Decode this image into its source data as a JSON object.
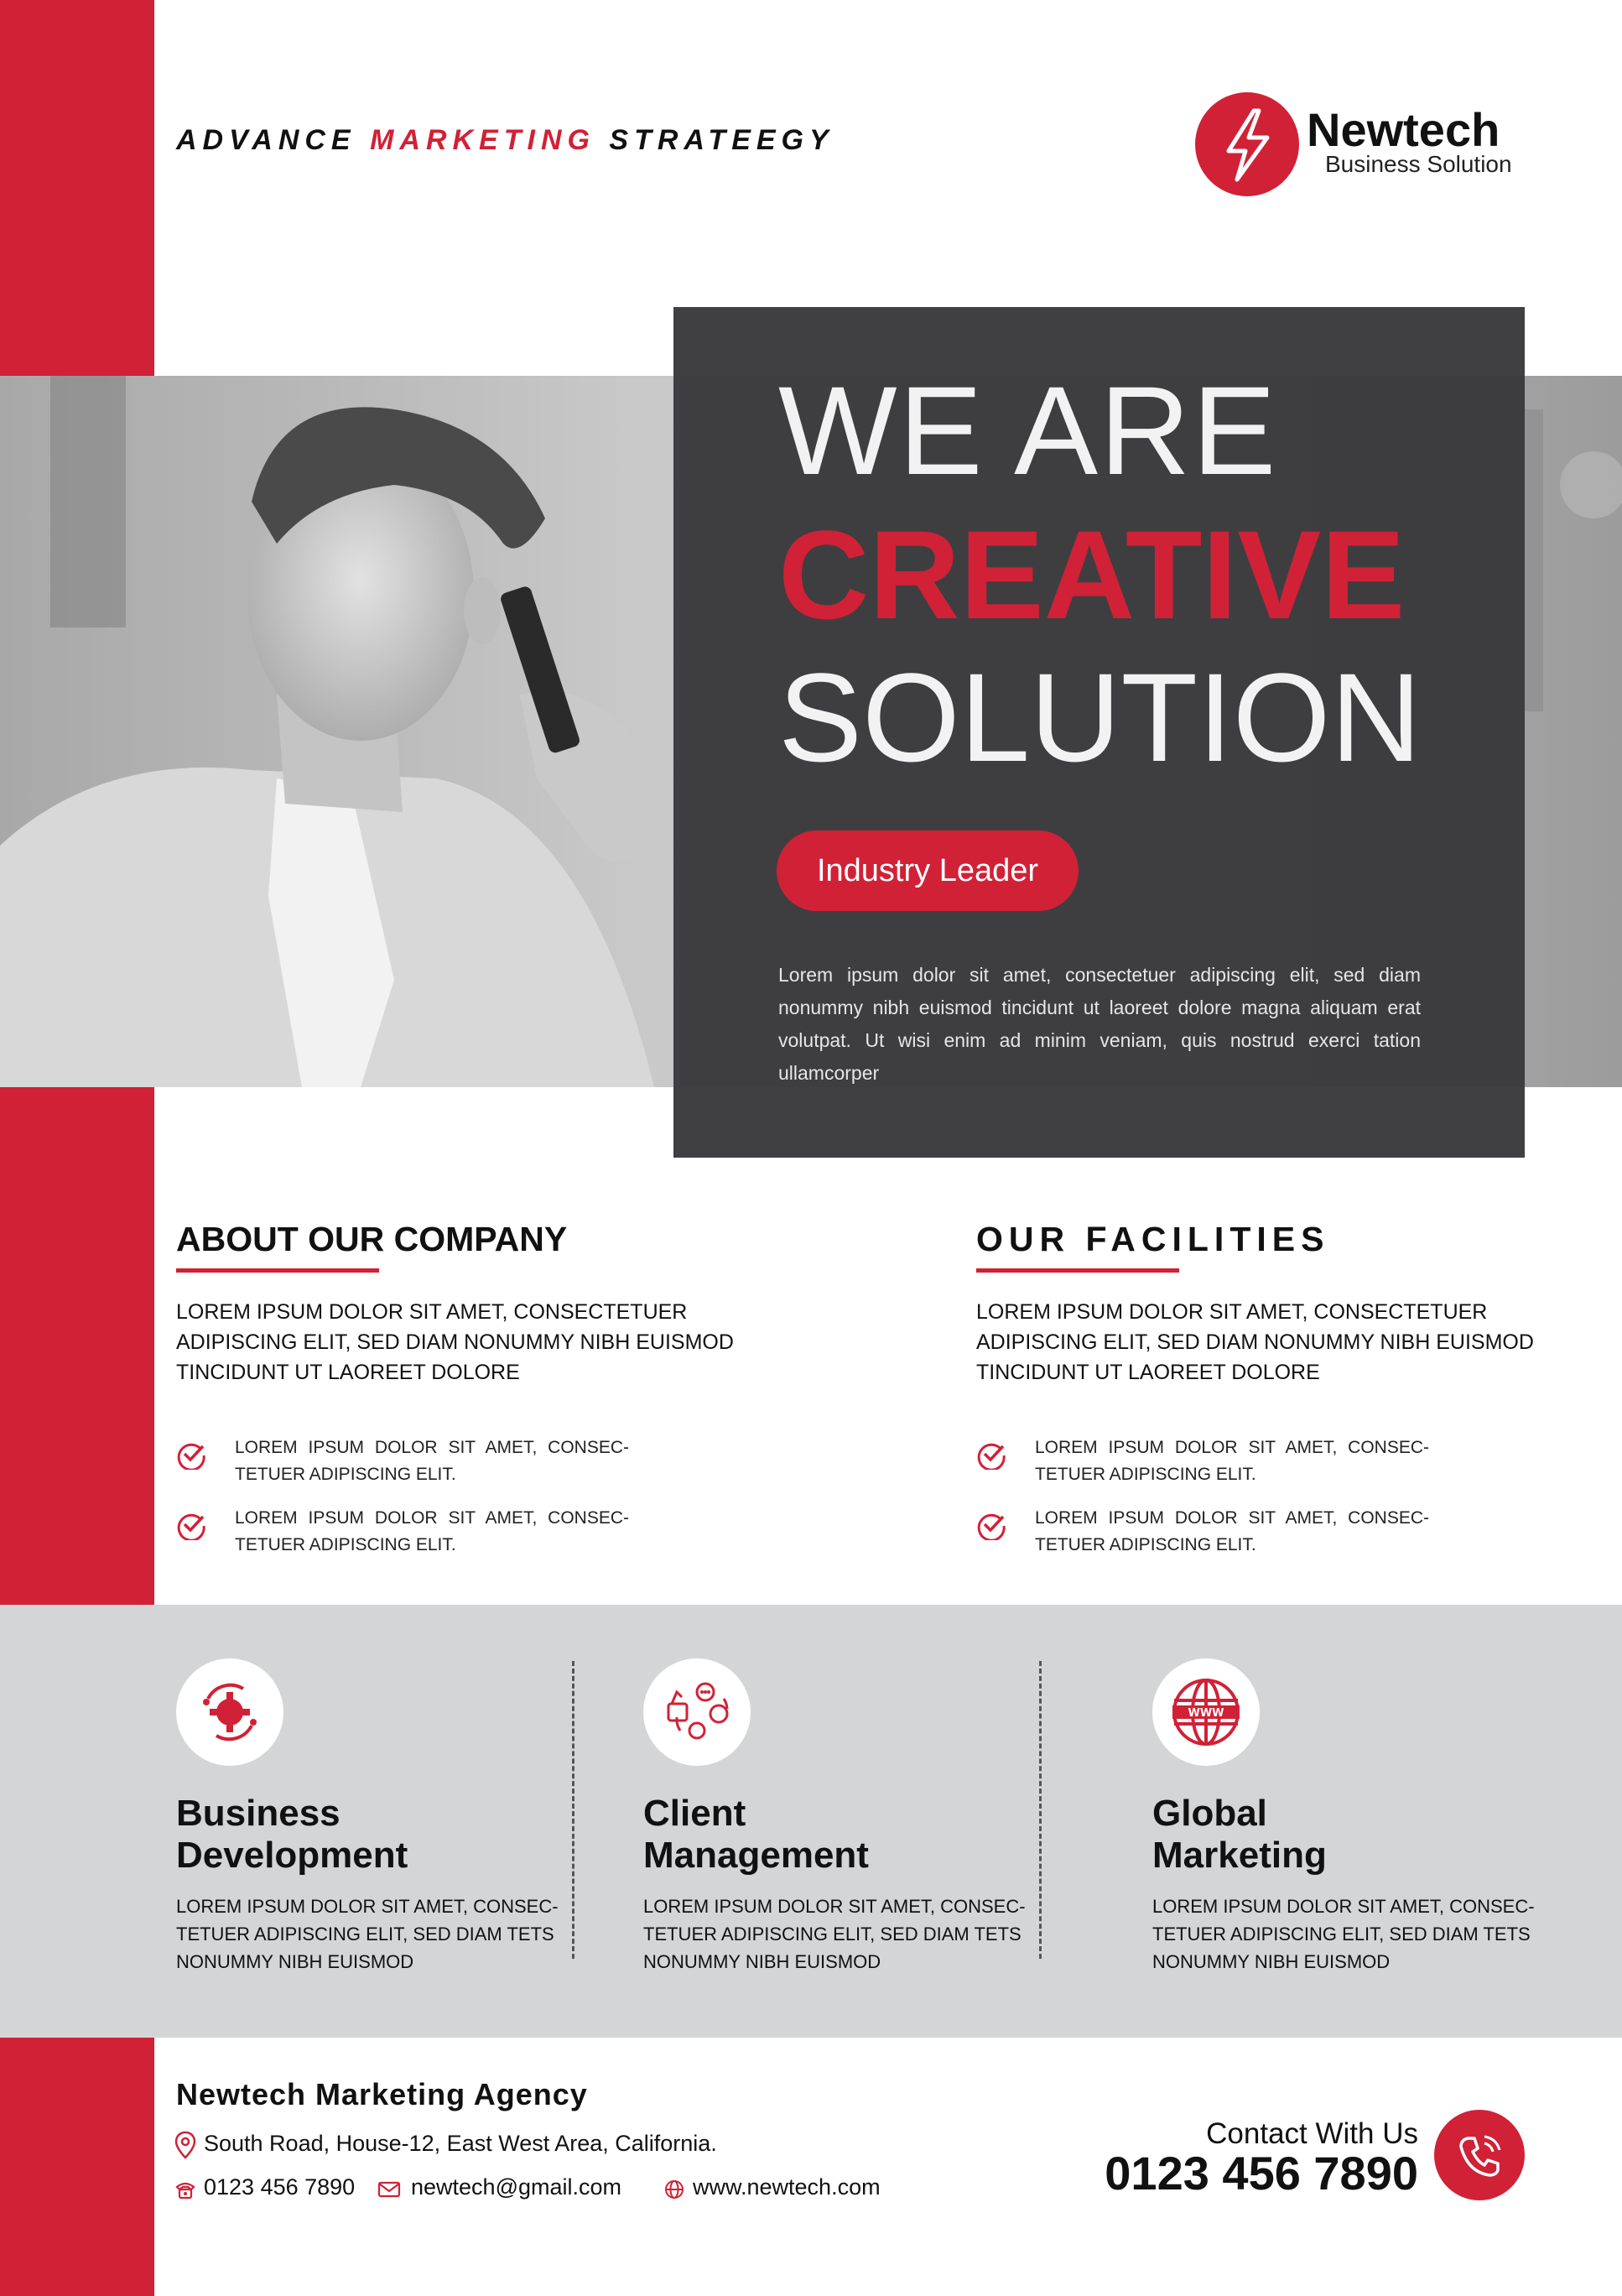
{
  "header": {
    "tagline_pre": "ADVANCE",
    "tagline_highlight": "MARKETING",
    "tagline_post": "STRATEEGY",
    "logo_name": "Newtech",
    "logo_sub": "Business Solution",
    "logo_icon": "lightning-bolt-icon"
  },
  "hero": {
    "line1": "WE ARE",
    "line2": "CREATIVE",
    "line3": "SOLUTION",
    "pill": "Industry Leader",
    "text": "Lorem ipsum dolor sit amet, consectetuer adipiscing elit, sed diam nonummy nibh euismod tincidunt ut laoreet dolore magna aliquam erat volutpat. Ut wisi enim ad minim veniam, quis nostrud exerci tation ullamcorper"
  },
  "about": {
    "title": "ABOUT OUR COMPANY",
    "body": "LOREM IPSUM DOLOR SIT AMET, CONSECTETUER ADIPISCING ELIT, SED DIAM NONUMMY NIBH EUISMOD TINCIDUNT UT LAOREET DOLORE",
    "items": [
      "LOREM IPSUM DOLOR SIT AMET, CONSEC- TETUER ADIPISCING ELIT.",
      "LOREM IPSUM DOLOR SIT AMET, CONSEC- TETUER ADIPISCING ELIT."
    ]
  },
  "facilities": {
    "title": "OUR FACILITIES",
    "body": "LOREM IPSUM DOLOR SIT AMET, CONSECTETUER ADIPISCING ELIT, SED DIAM NONUMMY NIBH EUISMOD TINCIDUNT UT LAOREET DOLORE",
    "items": [
      "LOREM IPSUM DOLOR SIT AMET, CONSEC- TETUER ADIPISCING ELIT.",
      "LOREM IPSUM DOLOR SIT AMET, CONSEC- TETUER ADIPISCING ELIT."
    ]
  },
  "services": [
    {
      "icon": "gear-cycle-icon",
      "title_l1": "Business",
      "title_l2": "Development",
      "text": "LOREM IPSUM DOLOR SIT AMET, CONSEC- TETUER ADIPISCING ELIT, SED DIAM TETS NONUMMY NIBH EUISMOD"
    },
    {
      "icon": "client-management-icon",
      "title_l1": "Client",
      "title_l2": "Management",
      "text": "LOREM IPSUM DOLOR SIT AMET, CONSEC- TETUER ADIPISCING ELIT, SED DIAM TETS NONUMMY NIBH EUISMOD"
    },
    {
      "icon": "globe-www-icon",
      "title_l1": "Global",
      "title_l2": "Marketing",
      "text": "LOREM IPSUM DOLOR SIT AMET, CONSEC- TETUER ADIPISCING ELIT, SED DIAM TETS NONUMMY NIBH EUISMOD"
    }
  ],
  "footer": {
    "agency": "Newtech Marketing Agency",
    "address": "South Road, House-12, East West Area, California.",
    "phone": "0123 456 7890",
    "email": "newtech@gmail.com",
    "website": "www.newtech.com",
    "contact_label": "Contact With Us",
    "contact_phone": "0123 456 7890"
  },
  "colors": {
    "accent": "#d12136",
    "dark_panel": "#3a3a3d",
    "services_bg": "#d4d5d7"
  }
}
